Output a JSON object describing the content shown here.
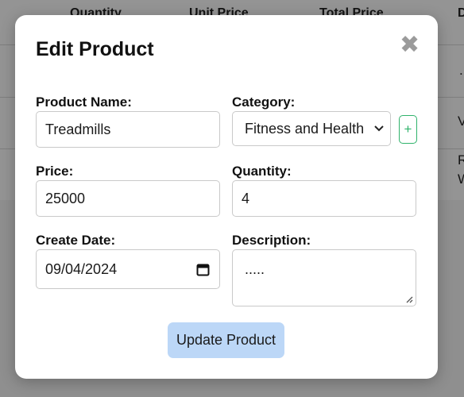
{
  "background_table": {
    "headers": [
      "Quantity",
      "Unit Price",
      "Total Price",
      "D"
    ],
    "row1_tail": "..",
    "row2_tail": "V",
    "row3_tail": [
      "R",
      "W"
    ]
  },
  "modal": {
    "title": "Edit Product",
    "close_symbol": "✖",
    "fields": {
      "product_name": {
        "label": "Product Name:",
        "value": "Treadmills"
      },
      "category": {
        "label": "Category:",
        "value": "Fitness and Health"
      },
      "price": {
        "label": "Price:",
        "value": "25000"
      },
      "quantity": {
        "label": "Quantity:",
        "value": "4"
      },
      "create_date": {
        "label": "Create Date:",
        "value": "09/04/2024"
      },
      "description": {
        "label": "Description:",
        "value": "....."
      }
    },
    "add_category_symbol": "+",
    "submit_label": "Update Product"
  },
  "colors": {
    "overlay": "#000000",
    "add_button": "#2fb36b",
    "submit_button": "#bcd7f7",
    "close_icon": "#9b9b9b"
  },
  "icons": [
    "close-icon",
    "chevron-down-icon",
    "plus-icon",
    "calendar-icon",
    "resize-handle-icon"
  ]
}
